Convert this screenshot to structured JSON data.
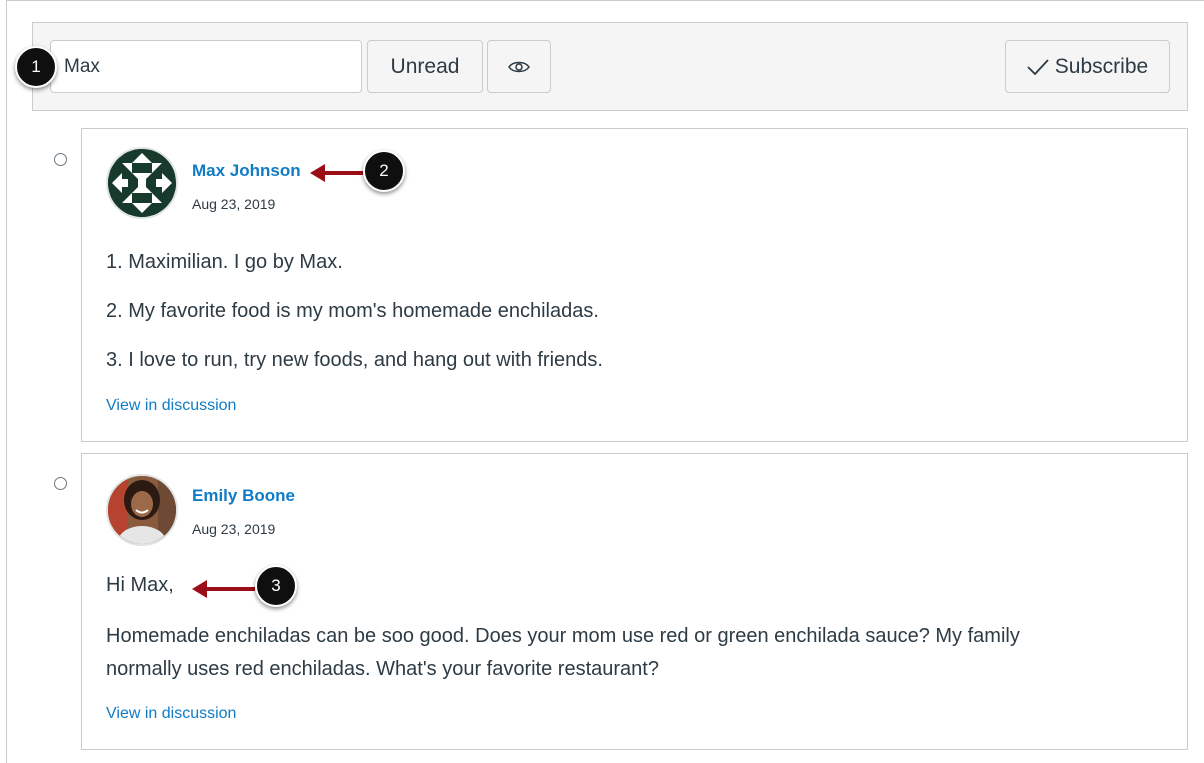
{
  "toolbar": {
    "search_value": "Max",
    "unread_label": "Unread",
    "eye_icon": "eye-icon",
    "subscribe_label": "Subscribe",
    "check_icon": "checkmark-icon"
  },
  "callouts": [
    "1",
    "2",
    "3"
  ],
  "entries": [
    {
      "author": "Max Johnson",
      "date": "Aug 23, 2019",
      "avatar": "quilt-pattern-avatar",
      "paragraphs": [
        "1. Maximilian. I go by Max.",
        "2. My favorite food is my mom's homemade enchiladas.",
        "3. I love to run, try new foods, and hang out with friends."
      ],
      "link": "View in discussion"
    },
    {
      "author": "Emily Boone",
      "date": "Aug 23, 2019",
      "avatar": "portrait-photo-avatar",
      "paragraphs": [
        "Hi Max,",
        "Homemade enchiladas can be soo good. Does your mom use red or green enchilada sauce? My family",
        "normally uses red enchiladas. What's your favorite restaurant?"
      ],
      "link": "View in discussion"
    }
  ],
  "colors": {
    "link": "#0f7cc5",
    "arrow": "#9b0d17",
    "border": "#c7cdd1",
    "toolbar_bg": "#f5f5f5"
  }
}
